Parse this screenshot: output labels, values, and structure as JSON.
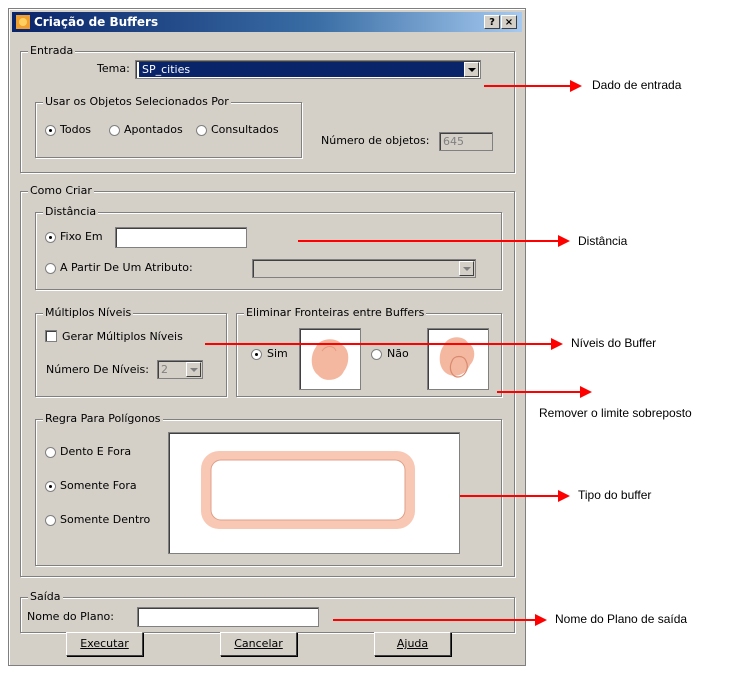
{
  "window": {
    "title": "Criação de Buffers",
    "help_btn": "?",
    "close_btn": "×"
  },
  "entrada": {
    "legend": "Entrada",
    "tema_label": "Tema:",
    "tema_value": "SP_cities",
    "usar_legend": "Usar os Objetos Selecionados Por",
    "opt_todos": "Todos",
    "opt_apontados": "Apontados",
    "opt_consultados": "Consultados",
    "num_obj_label": "Número de objetos:",
    "num_obj_value": "645"
  },
  "como_criar": {
    "legend": "Como Criar",
    "distancia": {
      "legend": "Distância",
      "fixo_label": "Fixo Em",
      "fixo_value": "",
      "atributo_label": "A Partir De Um Atributo:"
    },
    "multiplos": {
      "legend": "Múltiplos Níveis",
      "gerar_label": "Gerar Múltiplos Níveis",
      "num_niveis_label": "Número De Níveis:",
      "num_niveis_value": "2"
    },
    "eliminar": {
      "legend": "Eliminar Fronteiras entre Buffers",
      "sim_label": "Sim",
      "nao_label": "Não"
    },
    "regra": {
      "legend": "Regra Para Polígonos",
      "opt_dentro_fora": "Dento E Fora",
      "opt_somente_fora": "Somente Fora",
      "opt_somente_dentro": "Somente Dentro"
    }
  },
  "saida": {
    "legend": "Saída",
    "nome_label": "Nome do Plano:",
    "nome_value": ""
  },
  "buttons": {
    "executar": "Executar",
    "cancelar": "Cancelar",
    "ajuda": "Ajuda"
  },
  "annotations": {
    "dado_entrada": "Dado de entrada",
    "distancia": "Distância",
    "niveis": "Níveis do Buffer",
    "remover": "Remover o limite sobreposto",
    "tipo": "Tipo do buffer",
    "nome_plano": "Nome do Plano de saída"
  },
  "colors": {
    "annotation_arrow": "#ff0000",
    "title_bar": "#0a246a",
    "selected_field": "#0a246a",
    "shape_fill": "#f4b7a0"
  }
}
